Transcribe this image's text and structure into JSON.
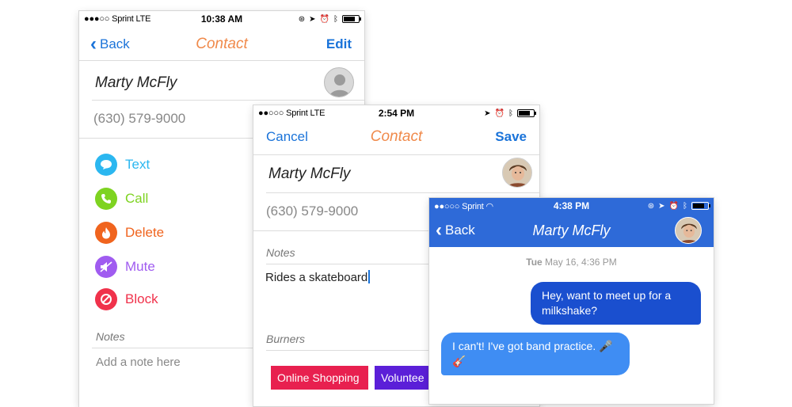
{
  "phone1": {
    "status": {
      "carrier": "●●●○○ Sprint  LTE",
      "time": "10:38 AM"
    },
    "nav": {
      "back": "Back",
      "title": "Contact",
      "right": "Edit"
    },
    "name": "Marty McFly",
    "phone": "(630) 579-9000",
    "actions": [
      {
        "label": "Text",
        "color": "#2bb7f0",
        "icon": "chat-icon"
      },
      {
        "label": "Call",
        "color": "#7ed321",
        "icon": "phone-icon"
      },
      {
        "label": "Delete",
        "color": "#f0641e",
        "icon": "flame-icon"
      },
      {
        "label": "Mute",
        "color": "#a05cf0",
        "icon": "mute-icon"
      },
      {
        "label": "Block",
        "color": "#f0324b",
        "icon": "block-icon"
      }
    ],
    "notes_label": "Notes",
    "notes_placeholder": "Add a note here"
  },
  "phone2": {
    "status": {
      "carrier": "●●○○○ Sprint  LTE",
      "time": "2:54 PM"
    },
    "nav": {
      "left": "Cancel",
      "title": "Contact",
      "right": "Save"
    },
    "name": "Marty McFly",
    "phone": "(630) 579-9000",
    "notes_label": "Notes",
    "notes_value": "Rides a skateboard",
    "burners_label": "Burners",
    "tags": [
      {
        "label": "Online Shopping",
        "color": "#e8204f"
      },
      {
        "label": "Voluntee",
        "color": "#5b1fd8"
      }
    ]
  },
  "phone3": {
    "status": {
      "carrier": "●●○○○ Sprint",
      "time": "4:38 PM"
    },
    "header_color": "#2e6ad8",
    "nav": {
      "back": "Back",
      "title": "Marty McFly"
    },
    "timestamp_day": "Tue",
    "timestamp_rest": " May 16, 4:36 PM",
    "messages": [
      {
        "text": "Hey, want to meet up for a milkshake?",
        "from": "me"
      },
      {
        "text": "I can't! I've got band practice. 🎤🎸",
        "from": "them"
      }
    ]
  }
}
